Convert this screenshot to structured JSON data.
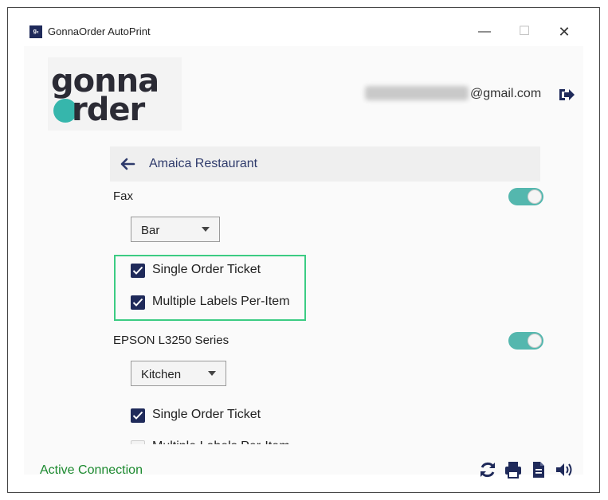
{
  "window": {
    "icon_text": "gₓ",
    "title": "GonnaOrder AutoPrint",
    "controls": {
      "minimize": "—",
      "maximize": "☐",
      "close": "✕"
    }
  },
  "logo": {
    "line1": "gonna",
    "line2": "rder"
  },
  "account": {
    "email_suffix": "@gmail.com"
  },
  "restaurant": {
    "name": "Amaica Restaurant"
  },
  "printers": [
    {
      "name": "Fax",
      "enabled": true,
      "category": "Bar",
      "options": [
        {
          "label": "Single Order Ticket",
          "checked": true
        },
        {
          "label": "Multiple Labels Per-Item",
          "checked": true
        }
      ]
    },
    {
      "name": "EPSON L3250 Series",
      "enabled": true,
      "category": "Kitchen",
      "options": [
        {
          "label": "Single Order Ticket",
          "checked": true
        },
        {
          "label": "Multiple Labels Per-Item",
          "checked": false
        }
      ]
    }
  ],
  "status": {
    "text": "Active Connection"
  },
  "footer_icons": [
    "refresh-icon",
    "printer-icon",
    "document-icon",
    "volume-icon"
  ],
  "colors": {
    "accent": "#54b7ae",
    "checkbox": "#1f2a5a",
    "status": "#1c8a2f",
    "highlight": "#3ccc83",
    "header_text": "#2e3a6b"
  }
}
